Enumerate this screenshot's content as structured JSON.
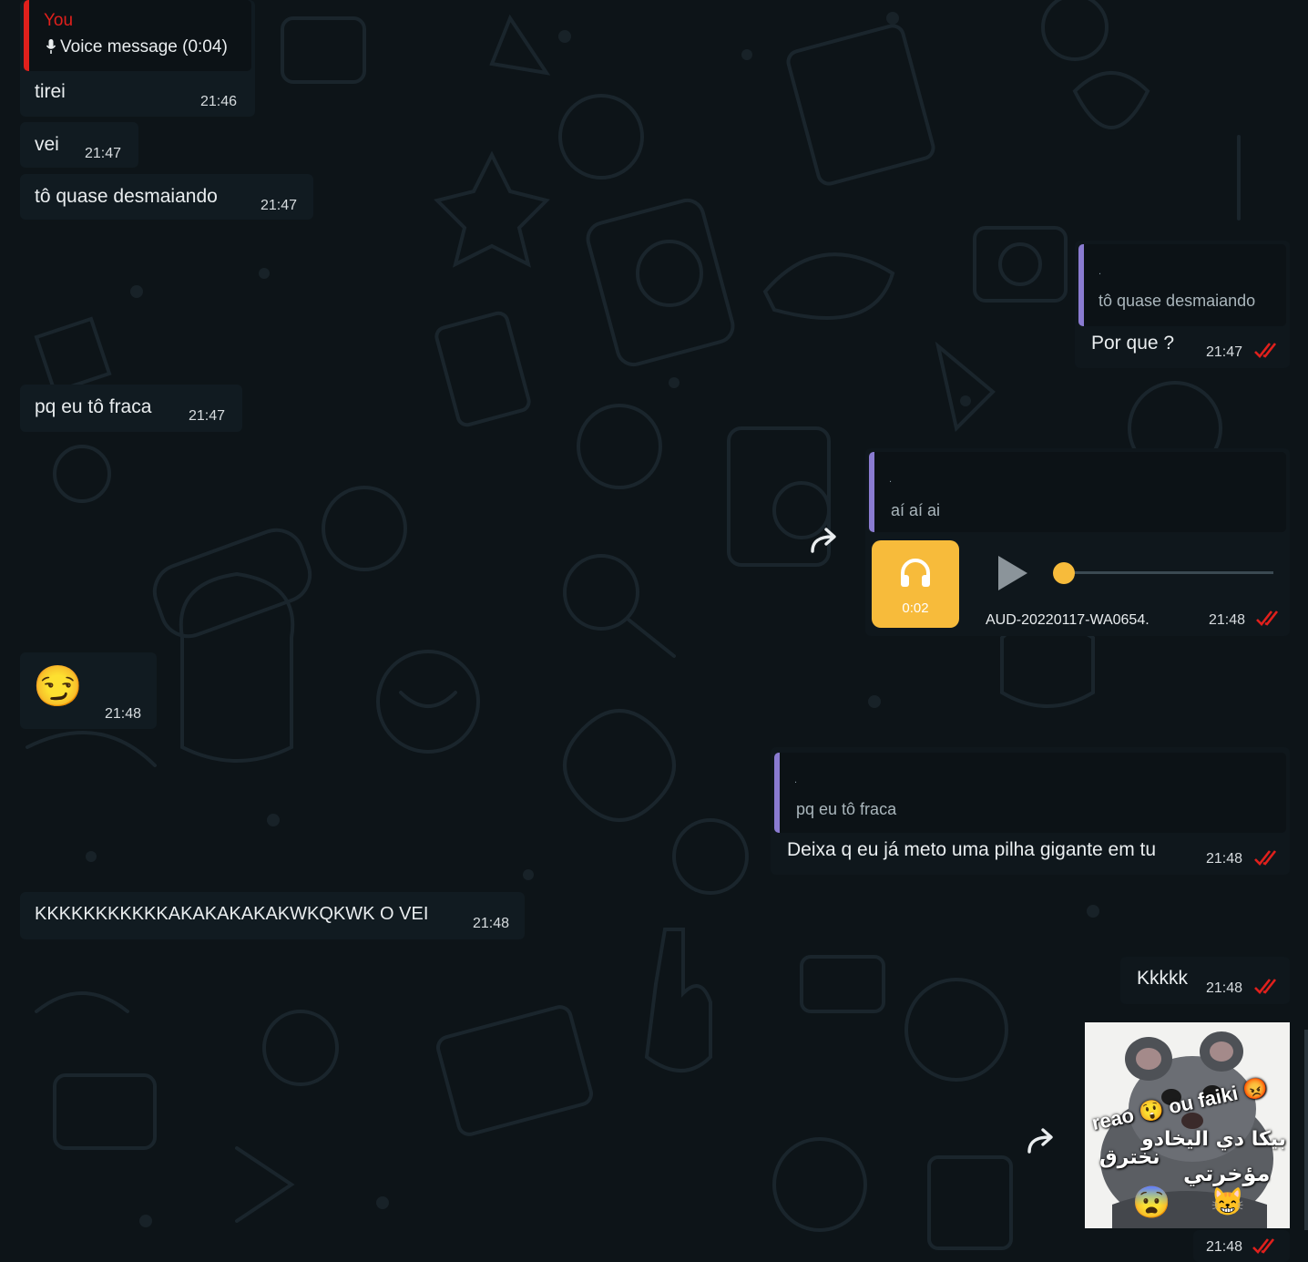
{
  "colors": {
    "background": "#0d1418",
    "incoming_bubble": "#111b21",
    "outgoing_bubble": "#0f171c",
    "read_ticks": "#e0201c",
    "reply_self_bar": "#e0201c",
    "reply_other_bar": "#8a7bd1",
    "audio_accent": "#f7bb3b"
  },
  "messages": {
    "m1": {
      "reply_sender": "You",
      "reply_icon": "microphone-icon",
      "reply_text": "Voice message (0:04)",
      "text": "tirei",
      "time": "21:46"
    },
    "m2": {
      "text": "vei",
      "time": "21:47"
    },
    "m3": {
      "text": "tô quase desmaiando",
      "time": "21:47"
    },
    "m4": {
      "reply_dot": ".",
      "reply_text": "tô quase desmaiando",
      "text": "Por que ?",
      "time": "21:47",
      "status_icon": "double-check-icon"
    },
    "m5": {
      "text": "pq eu tô fraca",
      "time": "21:47"
    },
    "m6": {
      "reply_dot": ".",
      "reply_text": "aí aí ai",
      "audio_icon": "headphones-icon",
      "duration": "0:02",
      "filename": "AUD-20220117-WA0654.",
      "progress": 0,
      "time": "21:48",
      "status_icon": "double-check-icon"
    },
    "m7": {
      "emoji": "😏",
      "time": "21:48"
    },
    "m8": {
      "reply_dot": ".",
      "reply_text": "pq eu tô fraca",
      "text": "Deixa q eu já meto uma pilha gigante em tu",
      "time": "21:48",
      "status_icon": "double-check-icon"
    },
    "m9": {
      "text": "KKKKKKKKKKKAKAKAKAKAKWKQKWK O VEI",
      "time": "21:48"
    },
    "m10": {
      "text": "Kkkkk",
      "time": "21:48",
      "status_icon": "double-check-icon"
    },
    "m11": {
      "sticker_line1": "reao",
      "sticker_line1b": "ou faiki",
      "sticker_arabic1": "بيكا دي اليخادو",
      "sticker_arabic2": "نخترق",
      "sticker_arabic3": "مؤخرتي",
      "time": "21:48",
      "status_icon": "double-check-icon"
    }
  }
}
